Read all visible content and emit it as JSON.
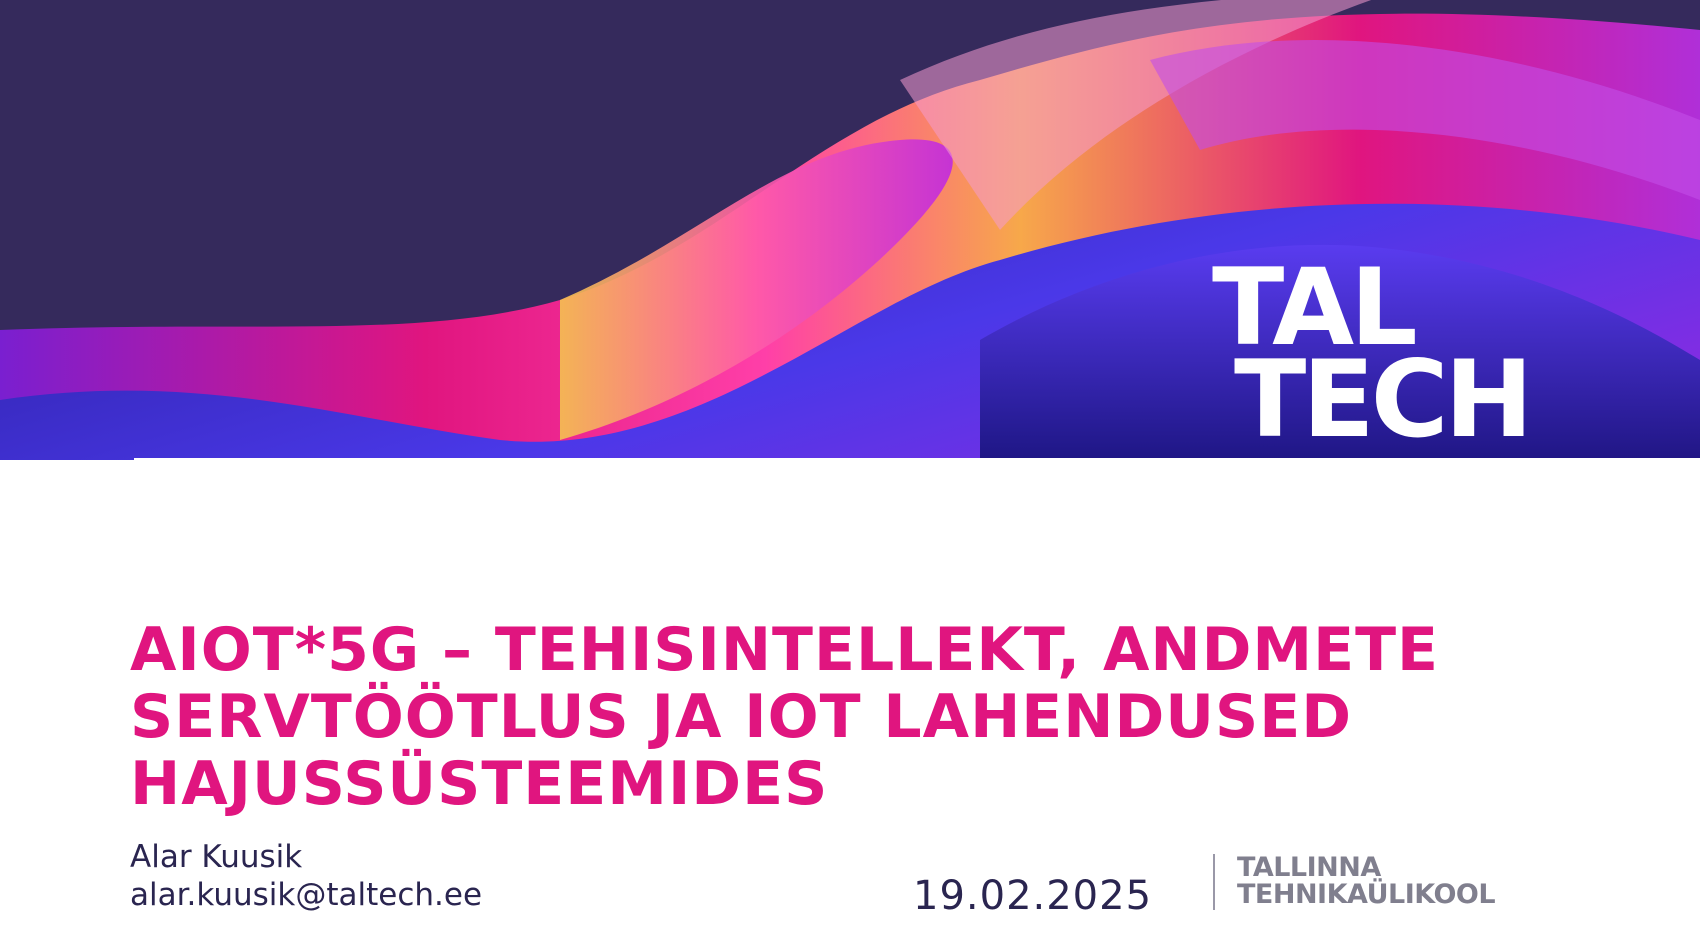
{
  "hero": {
    "image": "abstract-fluid-wave-background",
    "colors": [
      "#352a5c",
      "#e0157f",
      "#f7a84a",
      "#3b2fd6",
      "#8a2be2"
    ]
  },
  "logo": {
    "line1": "TAL",
    "line2": "TECH"
  },
  "title": {
    "line1": "AIOT*5G – TEHISINTELLEKT, ANDMETE",
    "line2": "SERVTÖÖTLUS JA IOT LAHENDUSED",
    "line3": "HAJUSSÜSTEEMIDES",
    "color": "#e0157f"
  },
  "author": {
    "name": "Alar Kuusik",
    "email": "alar.kuusik@taltech.ee"
  },
  "date": "19.02.2025",
  "university": {
    "line1": "TALLINNA",
    "line2": "TEHNIKAÜLIKOOL"
  }
}
